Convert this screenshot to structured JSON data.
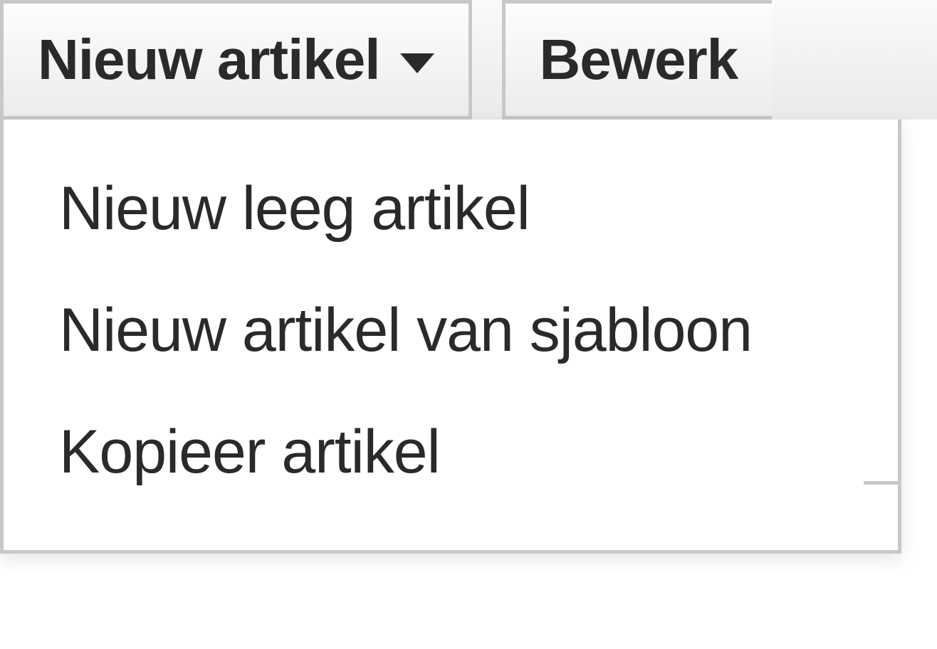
{
  "toolbar": {
    "new_article_button": "Nieuw artikel",
    "edit_button": "Bewerk"
  },
  "dropdown": {
    "items": [
      "Nieuw leeg artikel",
      "Nieuw artikel van sjabloon",
      "Kopieer artikel"
    ]
  }
}
